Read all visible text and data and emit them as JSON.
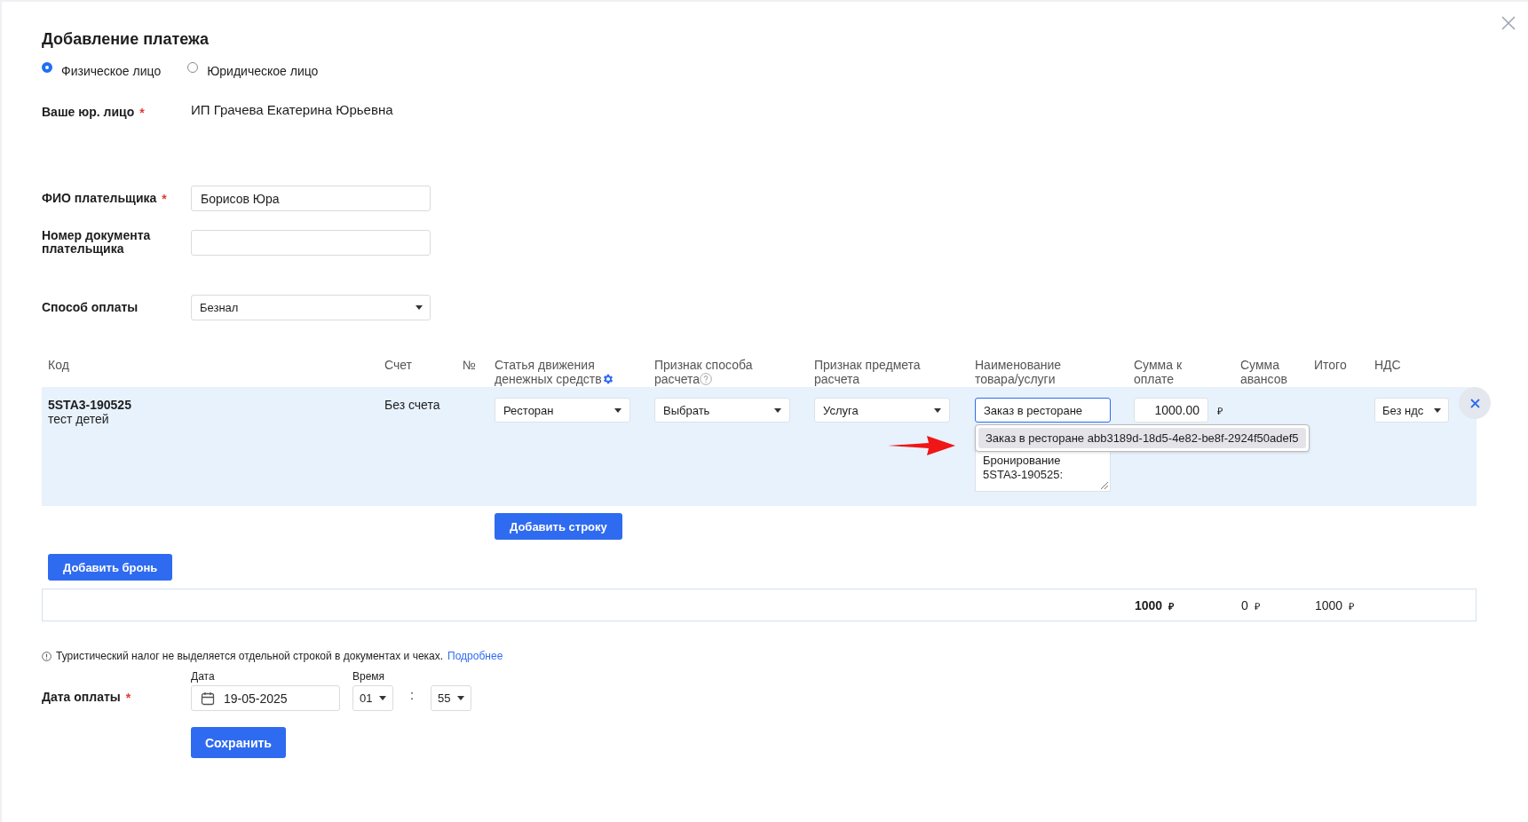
{
  "dialog": {
    "title": "Добавление платежа"
  },
  "payer_types": [
    {
      "label": "Физическое лицо",
      "selected": true
    },
    {
      "label": "Юридическое лицо",
      "selected": false
    }
  ],
  "fields": [
    {
      "kind": "static",
      "label": "Ваше юр. лицо",
      "required_mark": "*",
      "value": "ИП Грачева Екатерина Юрьевна"
    },
    {
      "kind": "input",
      "label": "ФИО плательщика",
      "required_mark": "*",
      "value": "Борисов Юра"
    },
    {
      "kind": "input",
      "label": "Номер документа плательщика"
    },
    {
      "kind": "select",
      "label": "Способ оплаты",
      "value": "Безнал"
    }
  ],
  "table": {
    "columns": [
      {
        "label": "Код"
      },
      {
        "label": "Счет"
      },
      {
        "label": "№"
      },
      {
        "label": "Статья движения денежных средств"
      },
      {
        "label": "Признак способа расчета"
      },
      {
        "label": "Признак предмета расчета"
      },
      {
        "label": "Наименование товара/услуги"
      },
      {
        "label": "Сумма к оплате"
      },
      {
        "label": "Сумма авансов"
      },
      {
        "label": "Итого"
      },
      {
        "label": "НДС"
      }
    ],
    "rows": [
      {
        "code": "5STA3-190525",
        "description": "тест детей",
        "account": "Без счета",
        "cash_flow_item": "Ресторан",
        "payment_method": "Выбрать",
        "payment_subject": "Услуга",
        "item_name": "Заказ в ресторане",
        "item_name_suggestion": "Заказ в ресторане abb3189d-18d5-4e82-be8f-2924f50adef5",
        "note": "Бронирование 5STA3-190525:",
        "amount": "1000.00",
        "currency": "₽",
        "vat": "Без ндс"
      }
    ]
  },
  "add_row_button": "Добавить строку",
  "add_booking_button": "Добавить бронь",
  "totals": [
    {
      "value": "1000",
      "currency": "₽",
      "emphasized": true
    },
    {
      "value": "0",
      "currency": "₽",
      "emphasized": false
    },
    {
      "value": "1000",
      "currency": "₽",
      "emphasized": false
    }
  ],
  "notice": {
    "text": "Туристический налог не выделяется отдельной строкой в документах и чеках.",
    "link": "Подробнее"
  },
  "payment_date": {
    "label": "Дата оплаты",
    "required_mark": "*",
    "date_label": "Дата",
    "date": "19-05-2025",
    "time_label": "Время",
    "hours": "01",
    "separator": ":",
    "minutes": "55"
  },
  "save_button": "Сохранить"
}
